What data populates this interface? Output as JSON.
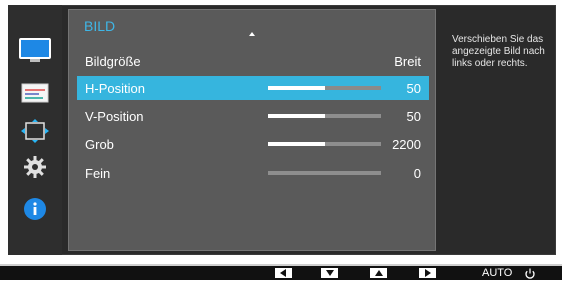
{
  "panel": {
    "title": "BILD",
    "rows": [
      {
        "label": "Bildgröße",
        "value": "Breit",
        "bar": false,
        "level": 0,
        "selected": false
      },
      {
        "label": "H-Position",
        "value": "50",
        "bar": true,
        "level": 0.5,
        "selected": true
      },
      {
        "label": "V-Position",
        "value": "50",
        "bar": true,
        "level": 0.5,
        "selected": false
      },
      {
        "label": "Grob",
        "value": "2200",
        "bar": true,
        "level": 0.5,
        "selected": false
      },
      {
        "label": "Fein",
        "value": "0",
        "bar": true,
        "level": 0,
        "selected": false
      }
    ]
  },
  "help": {
    "text": "Verschieben Sie das angezeigte Bild nach links oder rechts."
  },
  "rail": {
    "icons": [
      "monitor-icon",
      "color-icon",
      "size-position-icon",
      "settings-gear-icon",
      "info-icon"
    ],
    "active": "monitor-icon"
  },
  "bottom": {
    "auto_label": "AUTO"
  },
  "colors": {
    "accent": "#36b5de",
    "title": "#3fb6e6",
    "panel": "#5a5a5a",
    "frame": "#2a2a2a"
  }
}
